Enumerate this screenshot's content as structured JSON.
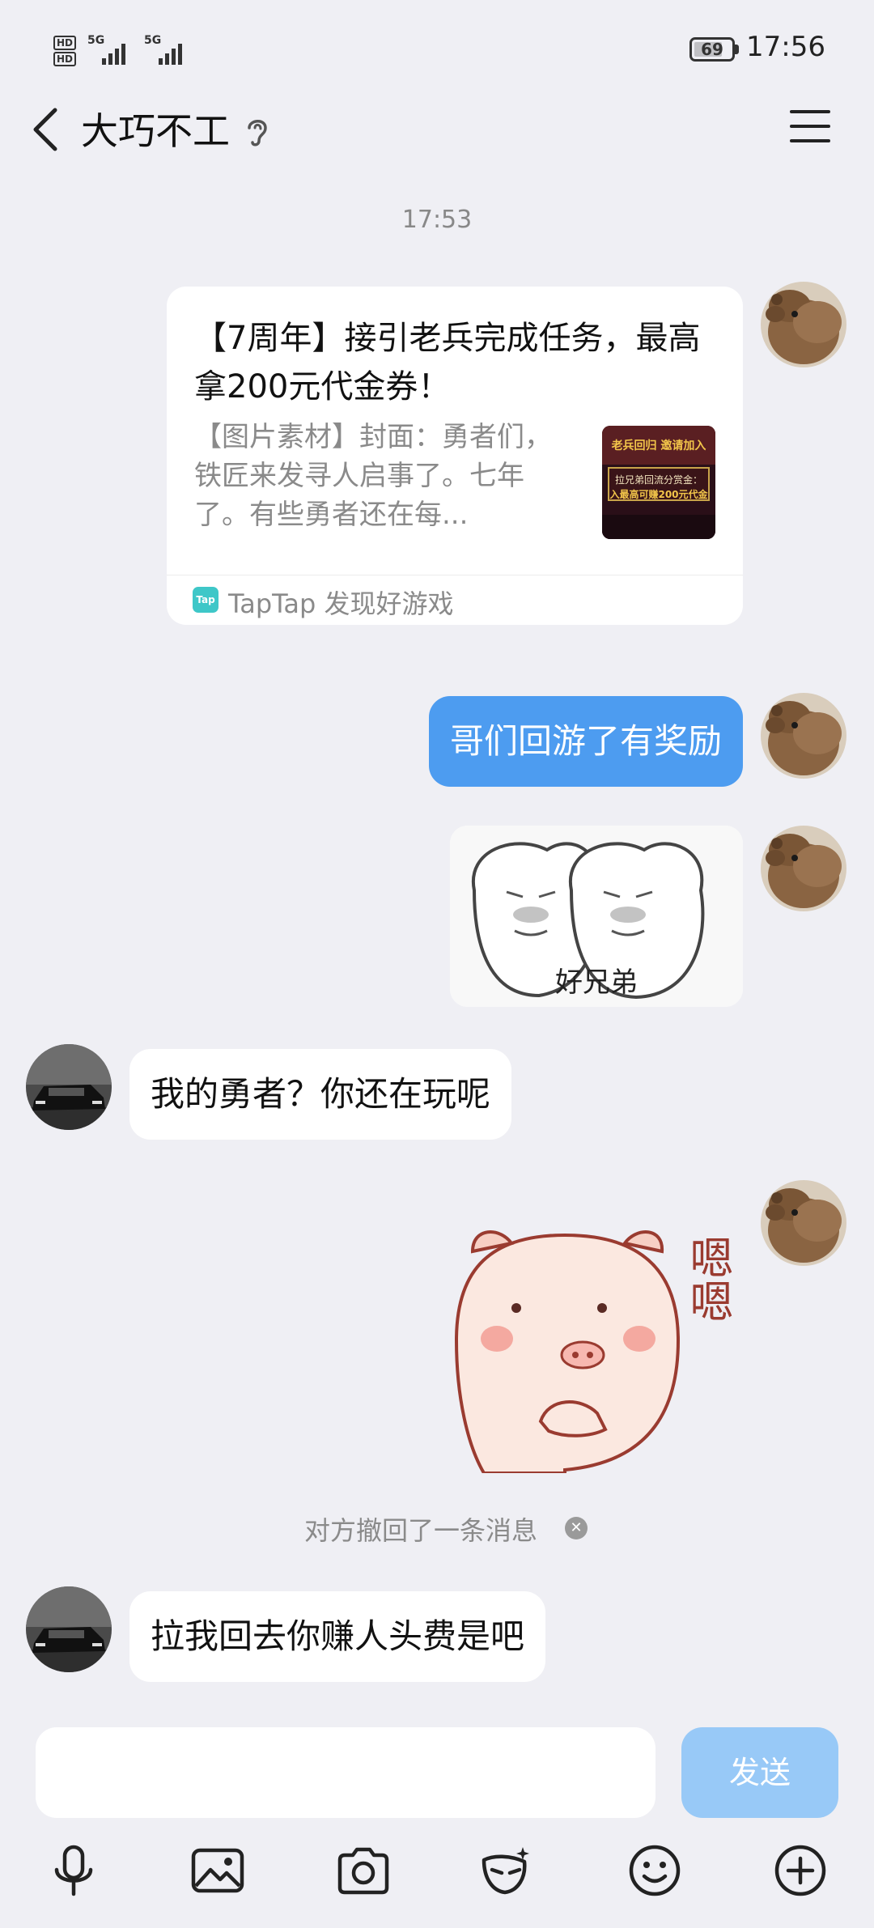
{
  "status_bar": {
    "hd_1": "HD",
    "hd_2": "HD",
    "net_1": "5G",
    "net_2": "5G",
    "battery": "69",
    "time": "17:56"
  },
  "header": {
    "title": "大巧不工"
  },
  "messages": {
    "timestamp": "17:53",
    "card": {
      "title": "【7周年】接引老兵完成任务，最高拿200元代金券！",
      "desc": "【图片素材】封面：勇者们，铁匠来发寻人启事了。七年了。有些勇者还在每...",
      "thumb_line1": "老兵回归 邀请加入",
      "thumb_line2": "拉兄弟回流分赏金：",
      "thumb_line3": "入最高可赚200元代金",
      "logo_text": "Tap",
      "source": "TapTap 发现好游戏"
    },
    "me_text_1": "哥们回游了有奖励",
    "sticker_1_caption": "好兄弟",
    "them_text_1": "我的勇者？你还在玩呢",
    "sticker_2_caption": "嗯嗯",
    "recall_notice": "对方撤回了一条消息",
    "them_text_2": "拉我回去你赚人头费是吧"
  },
  "input": {
    "placeholder": "",
    "send_label": "发送"
  },
  "toolbar": {
    "icons": [
      "microphone-icon",
      "image-icon",
      "camera-icon",
      "mask-icon",
      "emoji-icon",
      "plus-icon"
    ]
  },
  "colors": {
    "background": "#efeff4",
    "my_bubble": "#4d9cf0",
    "send_disabled": "#98c9f7",
    "taptap": "#3ec7c8"
  }
}
